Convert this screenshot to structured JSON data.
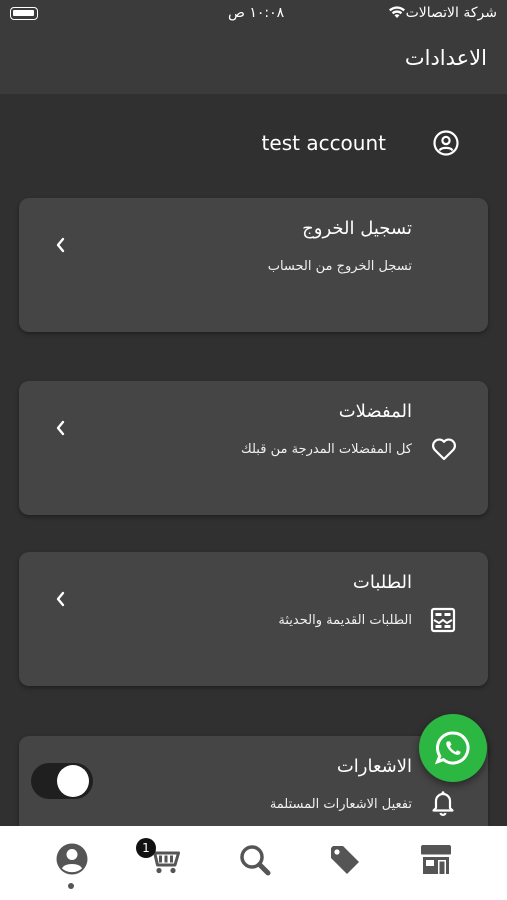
{
  "status_bar": {
    "carrier": "شركة الاتصالات",
    "time": "١٠:٠٨ ص"
  },
  "app_bar": {
    "title": "الاعدادات"
  },
  "account": {
    "name": "test account",
    "icon": "account-circle-icon"
  },
  "cards": {
    "logout": {
      "title": "تسجيل الخروج",
      "subtitle": "تسجل الخروج من الحساب"
    },
    "favorites": {
      "title": "المفضلات",
      "subtitle": "كل المفضلات المدرجة من قبلك",
      "icon": "heart-icon"
    },
    "orders": {
      "title": "الطلبات",
      "subtitle": "الطلبات القديمة والحديثة",
      "icon": "orders-icon"
    },
    "notifications": {
      "title": "الاشعارات",
      "subtitle": "تفعيل الاشعارات المستلمة",
      "icon": "bell-icon",
      "enabled": true
    }
  },
  "bottom_nav": {
    "items": [
      {
        "icon": "profile-icon",
        "active": true
      },
      {
        "icon": "cart-icon"
      },
      {
        "icon": "search-icon"
      },
      {
        "icon": "tag-icon"
      },
      {
        "icon": "store-icon"
      }
    ],
    "cart_badge": "1"
  },
  "floating": {
    "icon": "whatsapp-icon"
  },
  "colors": {
    "background": "#2f2f2f",
    "card": "#454545",
    "app_bar": "#3b3b3b",
    "whatsapp": "#2bb741",
    "nav": "#ffffff"
  }
}
